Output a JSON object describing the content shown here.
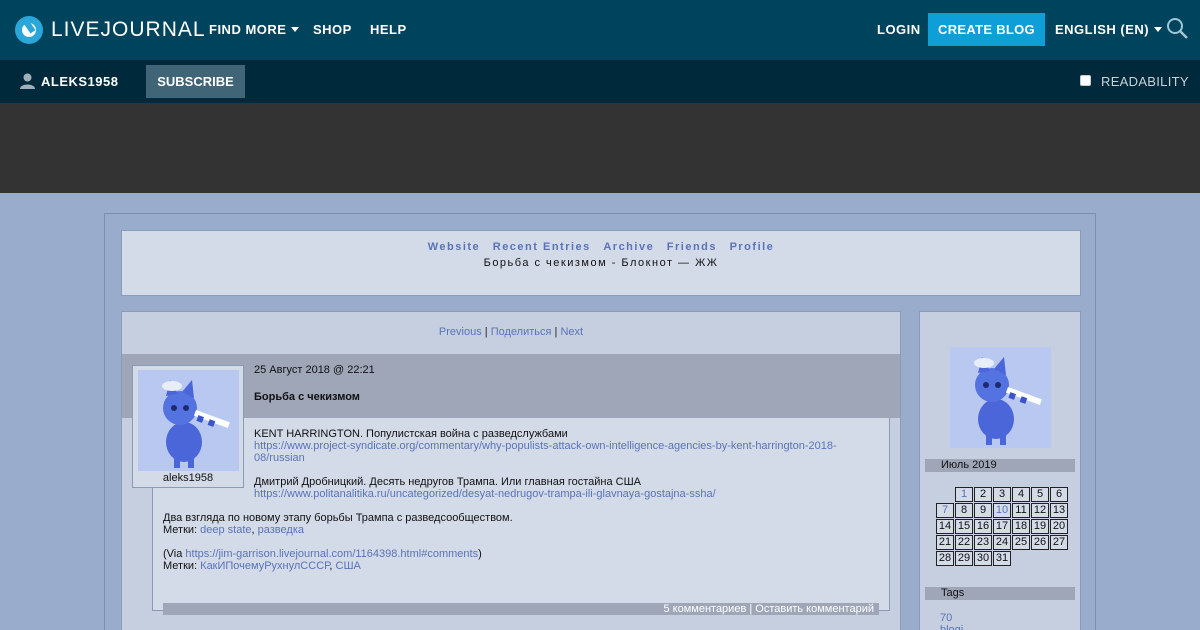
{
  "topbar": {
    "logo_text": "LIVEJOURNAL",
    "nav": [
      "FIND MORE",
      "SHOP",
      "HELP"
    ],
    "login": "LOGIN",
    "create_blog": "CREATE BLOG",
    "language": "ENGLISH (EN)"
  },
  "subbar": {
    "username": "ALEKS1958",
    "subscribe": "SUBSCRIBE",
    "readability": "READABILITY"
  },
  "journal": {
    "links": [
      "Website",
      "Recent Entries",
      "Archive",
      "Friends",
      "Profile"
    ],
    "title": "Борьба с чекизмом - Блокнот — ЖЖ"
  },
  "pagenav": {
    "previous": "Previous",
    "share": "Поделиться",
    "next": "Next",
    "sep": "|"
  },
  "entry": {
    "date": "25 Август 2018 @ 22:21",
    "subject": "Борьба с чекизмом",
    "userpic_name": "aleks1958",
    "p1_text": "KENT HARRINGTON. Популистская война с разведслужбами",
    "p1_link_a": "https://www.project-syndicate.org/commentary/why-populists-attack-own-intelligence-agencies-by-kent-harrington-2018-",
    "p1_link_b": "08/russian",
    "p2_text": "Дмитрий Дробницкий. Десять недругов Трампа. Или главная гостайна США",
    "p2_link": "https://www.politanalitika.ru/uncategorized/desyat-nedrugov-trampa-ili-glavnaya-gostajna-ssha/",
    "p3_text": "Два взгляда по новому этапу борьбы Трампа с разведсообществом.",
    "tags_label": "Метки:",
    "tags1": [
      "deep state",
      "разведка"
    ],
    "via_open": "(Via ",
    "via_link": "https://jim-garrison.livejournal.com/1164398.html#comments",
    "via_close": ")",
    "tags2": [
      "КакИПочемуРухнулСССР",
      "США"
    ],
    "comments": "5 комментариев",
    "leave_comment": "Оставить комментарий"
  },
  "sidebar": {
    "month": "Июль 2019",
    "weeks": [
      [
        "",
        "1",
        "2",
        "3",
        "4",
        "5",
        "6"
      ],
      [
        "7",
        "8",
        "9",
        "10",
        "11",
        "12",
        "13"
      ],
      [
        "14",
        "15",
        "16",
        "17",
        "18",
        "19",
        "20"
      ],
      [
        "21",
        "22",
        "23",
        "24",
        "25",
        "26",
        "27"
      ],
      [
        "28",
        "29",
        "30",
        "31",
        "",
        "",
        ""
      ]
    ],
    "linked_days": [
      "1",
      "7",
      "10"
    ],
    "tags_header": "Tags",
    "tags": [
      "70",
      "blogi"
    ]
  },
  "colors": {
    "topbar": "#00435c",
    "subbar": "#002a3b",
    "accent": "#0e9fd8",
    "link": "#5a73b8",
    "page_bg": "#9aaccc"
  }
}
